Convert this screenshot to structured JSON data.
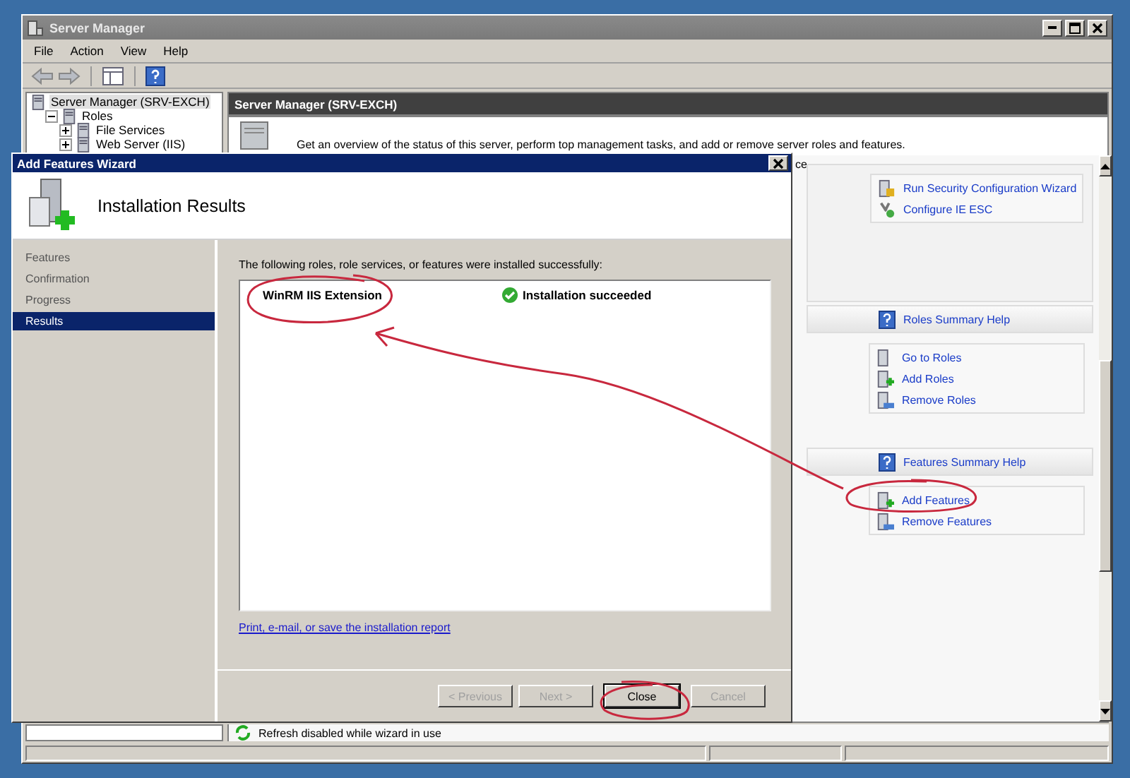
{
  "main_window": {
    "title": "Server Manager",
    "menu": [
      "File",
      "Action",
      "View",
      "Help"
    ],
    "tree": [
      {
        "label": "Server Manager (SRV-EXCH)",
        "selected": true,
        "children": [
          {
            "label": "Roles",
            "selected": false,
            "expanded": true,
            "children": [
              {
                "label": "File Services",
                "selected": false,
                "expanded": false
              },
              {
                "label": "Web Server (IIS)",
                "selected": false,
                "expanded": false
              }
            ]
          }
        ]
      }
    ],
    "header": "Server Manager (SRV-EXCH)",
    "overview": "Get an overview of the status of this server, perform top management tasks, and add or remove server roles and features.",
    "partial_text": "ce",
    "task_links": [
      "Run Security Configuration Wizard",
      "Configure IE ESC"
    ],
    "sections": [
      {
        "help": "Roles Summary Help",
        "links": [
          "Go to Roles",
          "Add Roles",
          "Remove Roles"
        ]
      },
      {
        "help": "Features Summary Help",
        "links": [
          "Add Features",
          "Remove Features"
        ]
      }
    ],
    "status": "Refresh disabled while wizard in use"
  },
  "wizard": {
    "title": "Add Features Wizard",
    "heading": "Installation Results",
    "steps": [
      {
        "label": "Features",
        "selected": false
      },
      {
        "label": "Confirmation",
        "selected": false
      },
      {
        "label": "Progress",
        "selected": false
      },
      {
        "label": "Results",
        "selected": true
      }
    ],
    "intro": "The following roles, role services, or features were installed successfully:",
    "results": [
      {
        "name": "WinRM IIS Extension",
        "status": "Installation succeeded"
      }
    ],
    "report_link": "Print, e-mail, or save the installation report",
    "buttons": [
      {
        "label": "< Previous",
        "disabled": true
      },
      {
        "label": "Next >",
        "disabled": true
      },
      {
        "label": "Close",
        "disabled": false
      },
      {
        "label": "Cancel",
        "disabled": true
      }
    ]
  }
}
